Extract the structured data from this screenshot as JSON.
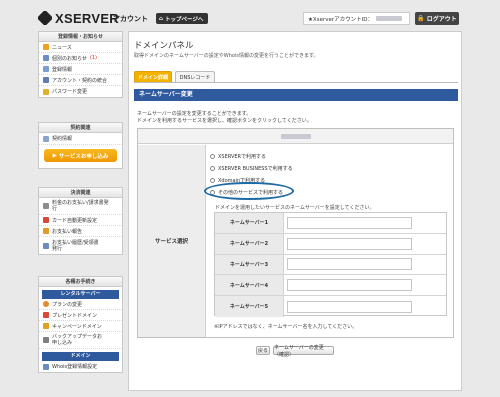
{
  "header": {
    "logo_text": "XSERVER",
    "logo_sub": "アカウント",
    "top_page_label": "トップページへ",
    "account_id_label": "★XserverアカウントID：",
    "logout_label": "ログアウト"
  },
  "sidebar": {
    "info": {
      "title": "登録情報・お知らせ",
      "items": [
        {
          "label": "ニュース",
          "icon": "news-icon"
        },
        {
          "label": "個別のお知らせ",
          "badge": "(1)",
          "icon": "mail-icon"
        },
        {
          "label": "登録情報",
          "icon": "document-icon"
        },
        {
          "label": "アカウント・契約の統合",
          "icon": "user-icon"
        },
        {
          "label": "パスワード変更",
          "icon": "key-icon"
        }
      ]
    },
    "contract": {
      "title": "契約関連",
      "items": [
        {
          "label": "契約情報",
          "icon": "contract-icon"
        }
      ],
      "button_label": "サービスお申し込み"
    },
    "payment": {
      "title": "決済関連",
      "items": [
        {
          "label": "料金のお支払い/請求書発行",
          "icon": "bill-icon"
        },
        {
          "label": "カード自動更新設定",
          "icon": "card-icon"
        },
        {
          "label": "お支払い報告",
          "icon": "report-icon"
        },
        {
          "label": "お支払い履歴/受領書発行",
          "icon": "receipt-icon"
        }
      ]
    },
    "procedures": {
      "title": "各種お手続き",
      "rental_title": "レンタルサーバー",
      "rental_items": [
        {
          "label": "プランの変更",
          "icon": "plan-icon"
        },
        {
          "label": "プレゼントドメイン",
          "icon": "gift-icon"
        },
        {
          "label": "キャンペーンドメイン",
          "icon": "campaign-icon"
        },
        {
          "label": "バックアップデータお申し込み",
          "icon": "backup-icon"
        }
      ],
      "domain_title": "ドメイン",
      "domain_items": [
        {
          "label": "Whois登録情報設定",
          "icon": "whois-icon"
        }
      ]
    }
  },
  "main": {
    "title": "ドメインパネル",
    "description": "取得ドメインのネームサーバーの設定やWhois情報の変更を行うことができます。",
    "tabs": [
      {
        "label": "ドメイン詳細",
        "active": true
      },
      {
        "label": "DNSレコード",
        "active": false
      }
    ],
    "section_title": "ネームサーバー変更",
    "intro_1": "ネームサーバーの設定を変更することができます。",
    "intro_2": "ドメインを利用するサービスを選択し、確認ボタンをクリックしてください。",
    "service_label": "サービス選択",
    "radio_options": [
      "XSERVERで利用する",
      "XSERVER BUSINESSで利用する",
      "Xdomainで利用する",
      "その他のサービスで利用する"
    ],
    "ns_note": "ドメインを運用したいサービスのネームサーバーを設定してください。",
    "nameservers": [
      {
        "label": "ネームサーバー1",
        "value": ""
      },
      {
        "label": "ネームサーバー2",
        "value": ""
      },
      {
        "label": "ネームサーバー3",
        "value": ""
      },
      {
        "label": "ネームサーバー4",
        "value": ""
      },
      {
        "label": "ネームサーバー5",
        "value": ""
      }
    ],
    "ip_note": "※IPアドレスではなく、ネームサーバー名を入力してください。",
    "back_label": "戻る",
    "confirm_label": "ネームサーバーの変更（確認）"
  },
  "colors": {
    "accent_blue": "#2f5a9e",
    "tab_active": "#f3b200",
    "apply_button": "#f3a400",
    "highlight_circle": "#1d6aa5"
  }
}
